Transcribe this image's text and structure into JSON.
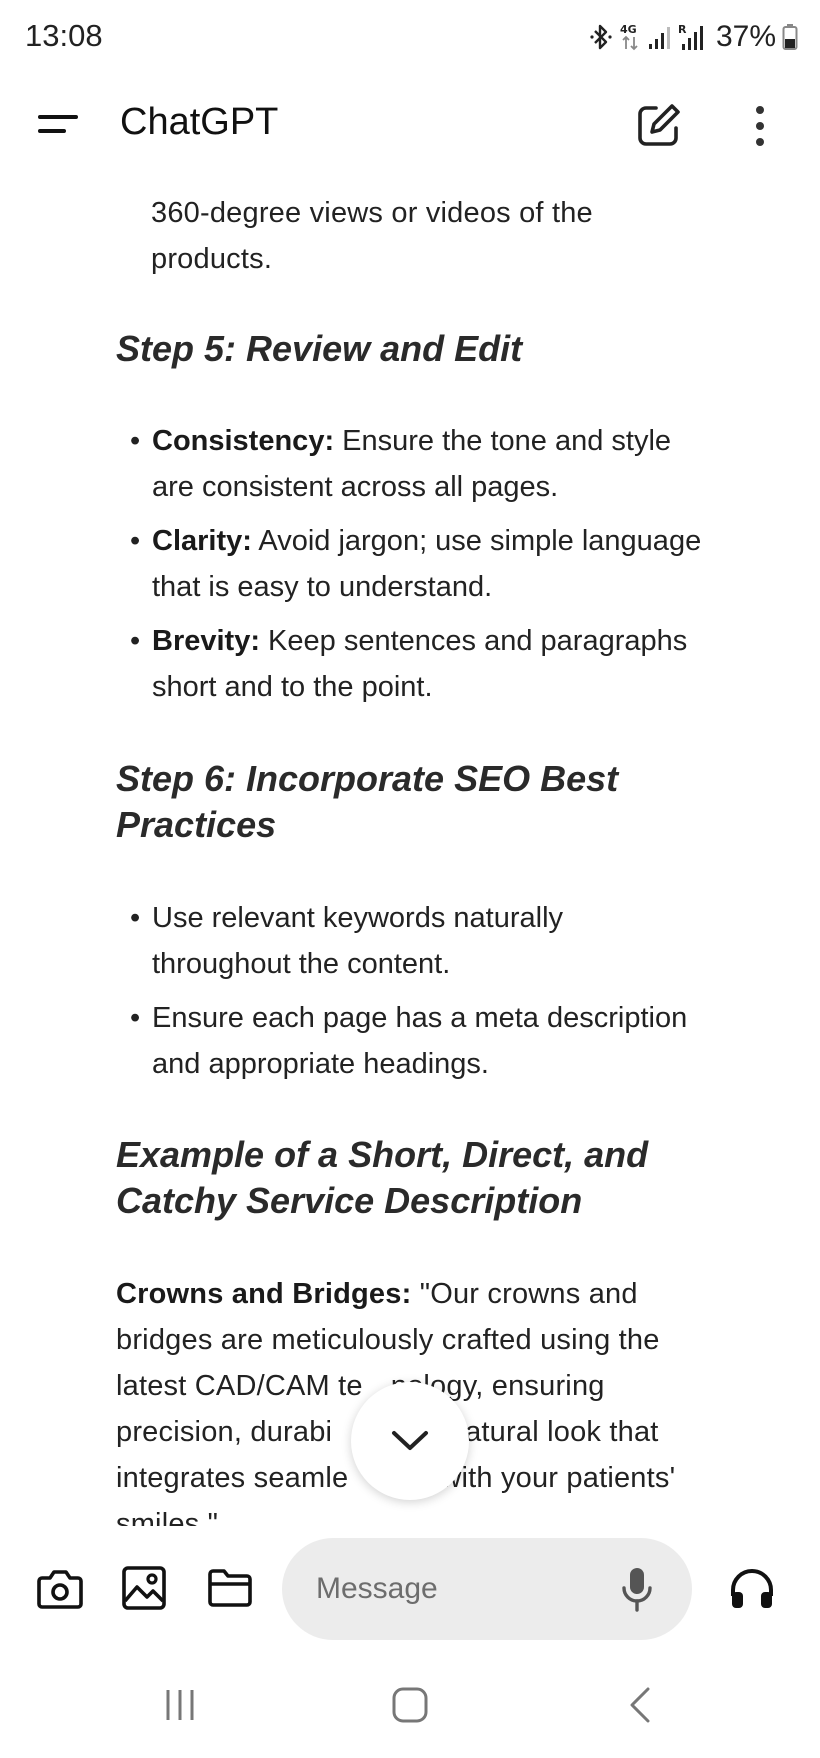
{
  "status_bar": {
    "time": "13:08",
    "battery": "37%",
    "icons": [
      "bluetooth-icon",
      "4g-icon",
      "signal-icon",
      "roaming-signal-icon",
      "battery-icon"
    ]
  },
  "app_bar": {
    "title": "ChatGPT",
    "icons": [
      "menu-icon",
      "new-chat-icon",
      "more-vertical-icon"
    ]
  },
  "content": {
    "intro_line1": "360-degree views or videos of the",
    "intro_line2": "products.",
    "step5": {
      "heading": "Step 5: Review and Edit",
      "items": [
        {
          "label": "Consistency:",
          "line1": " Ensure the tone and style",
          "line2": "are consistent across all pages."
        },
        {
          "label": "Clarity:",
          "line1": " Avoid jargon; use simple language",
          "line2": "that is easy to understand."
        },
        {
          "label": "Brevity:",
          "line1": " Keep sentences and paragraphs",
          "line2": "short and to the point."
        }
      ]
    },
    "step6": {
      "heading_line1": "Step 6: Incorporate SEO Best",
      "heading_line2": "Practices",
      "items": [
        {
          "line1": "Use relevant keywords naturally",
          "line2": "throughout the content."
        },
        {
          "line1": "Ensure each page has a meta description",
          "line2": "and appropriate headings."
        }
      ]
    },
    "example": {
      "heading_line1": "Example of a Short, Direct, and",
      "heading_line2": "Catchy Service Description",
      "label": "Crowns and Bridges:",
      "line1": " \"Our crowns and",
      "line2": "bridges are meticulously crafted using the",
      "line3a": "latest CAD/CAM te",
      "line3b": "nology, ensuring",
      "line4a": "precision, durabi",
      "line4b": "a natural look that",
      "line5a": "integrates seamle",
      "line5b": "with your patients'",
      "line6": "smiles.\""
    }
  },
  "composer": {
    "placeholder": "Message",
    "icons": [
      "camera-icon",
      "image-icon",
      "folder-icon",
      "mic-icon",
      "headphones-icon"
    ]
  },
  "nav_bar": {
    "icons": [
      "recents-icon",
      "home-icon",
      "back-icon"
    ]
  },
  "colors": {
    "background": "#ffffff",
    "text": "#222222",
    "input_bg": "#ececec"
  }
}
